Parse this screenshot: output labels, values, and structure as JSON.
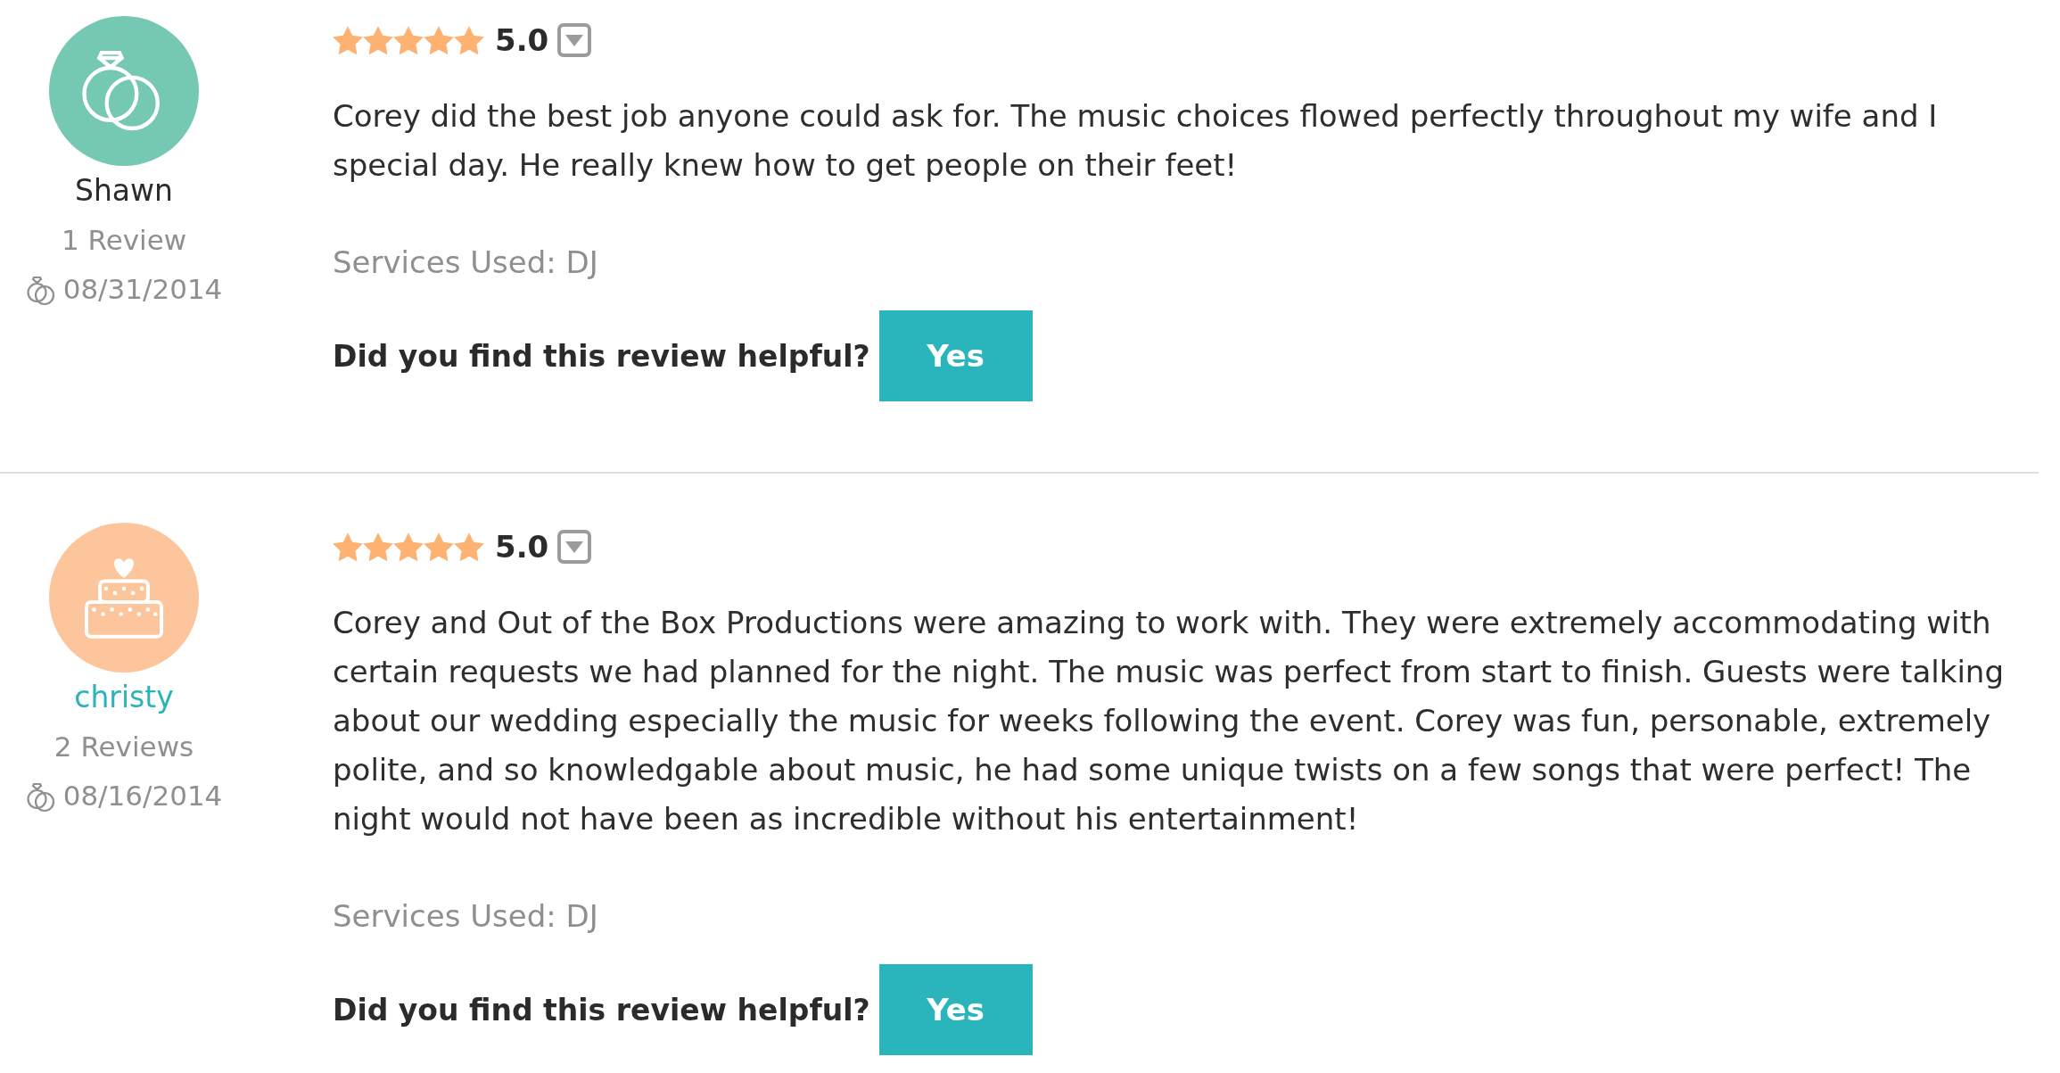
{
  "reviews": [
    {
      "reviewer": {
        "name": "Shawn",
        "linked": false,
        "avatar": {
          "kind": "rings",
          "color": "#75c8b1"
        },
        "review_count": "1 Review",
        "date": "08/31/2014"
      },
      "stars": 5,
      "rating": "5.0",
      "text": "Corey did the best job anyone could ask for. The music choices flowed perfectly throughout my wife and I special day. He really knew how to get people on their feet!",
      "services": "Services Used: DJ",
      "helpful_prompt": "Did you find this review helpful?",
      "helpful_button": "Yes"
    },
    {
      "reviewer": {
        "name": "christy",
        "linked": true,
        "avatar": {
          "kind": "cake",
          "color": "#fcc59b"
        },
        "review_count": "2 Reviews",
        "date": "08/16/2014"
      },
      "stars": 5,
      "rating": "5.0",
      "text": "Corey and Out of the Box Productions were amazing to work with. They were extremely accommodating with certain requests we had planned for the night. The music was perfect from start to finish. Guests were talking about our wedding especially the music for weeks following the event. Corey was fun, personable, extremely polite, and so knowledgable about music, he had some unique twists on a few songs that were perfect! The night would not have been as incredible without his entertainment!",
      "services": "Services Used: DJ",
      "helpful_prompt": "Did you find this review helpful?",
      "helpful_button": "Yes"
    }
  ]
}
